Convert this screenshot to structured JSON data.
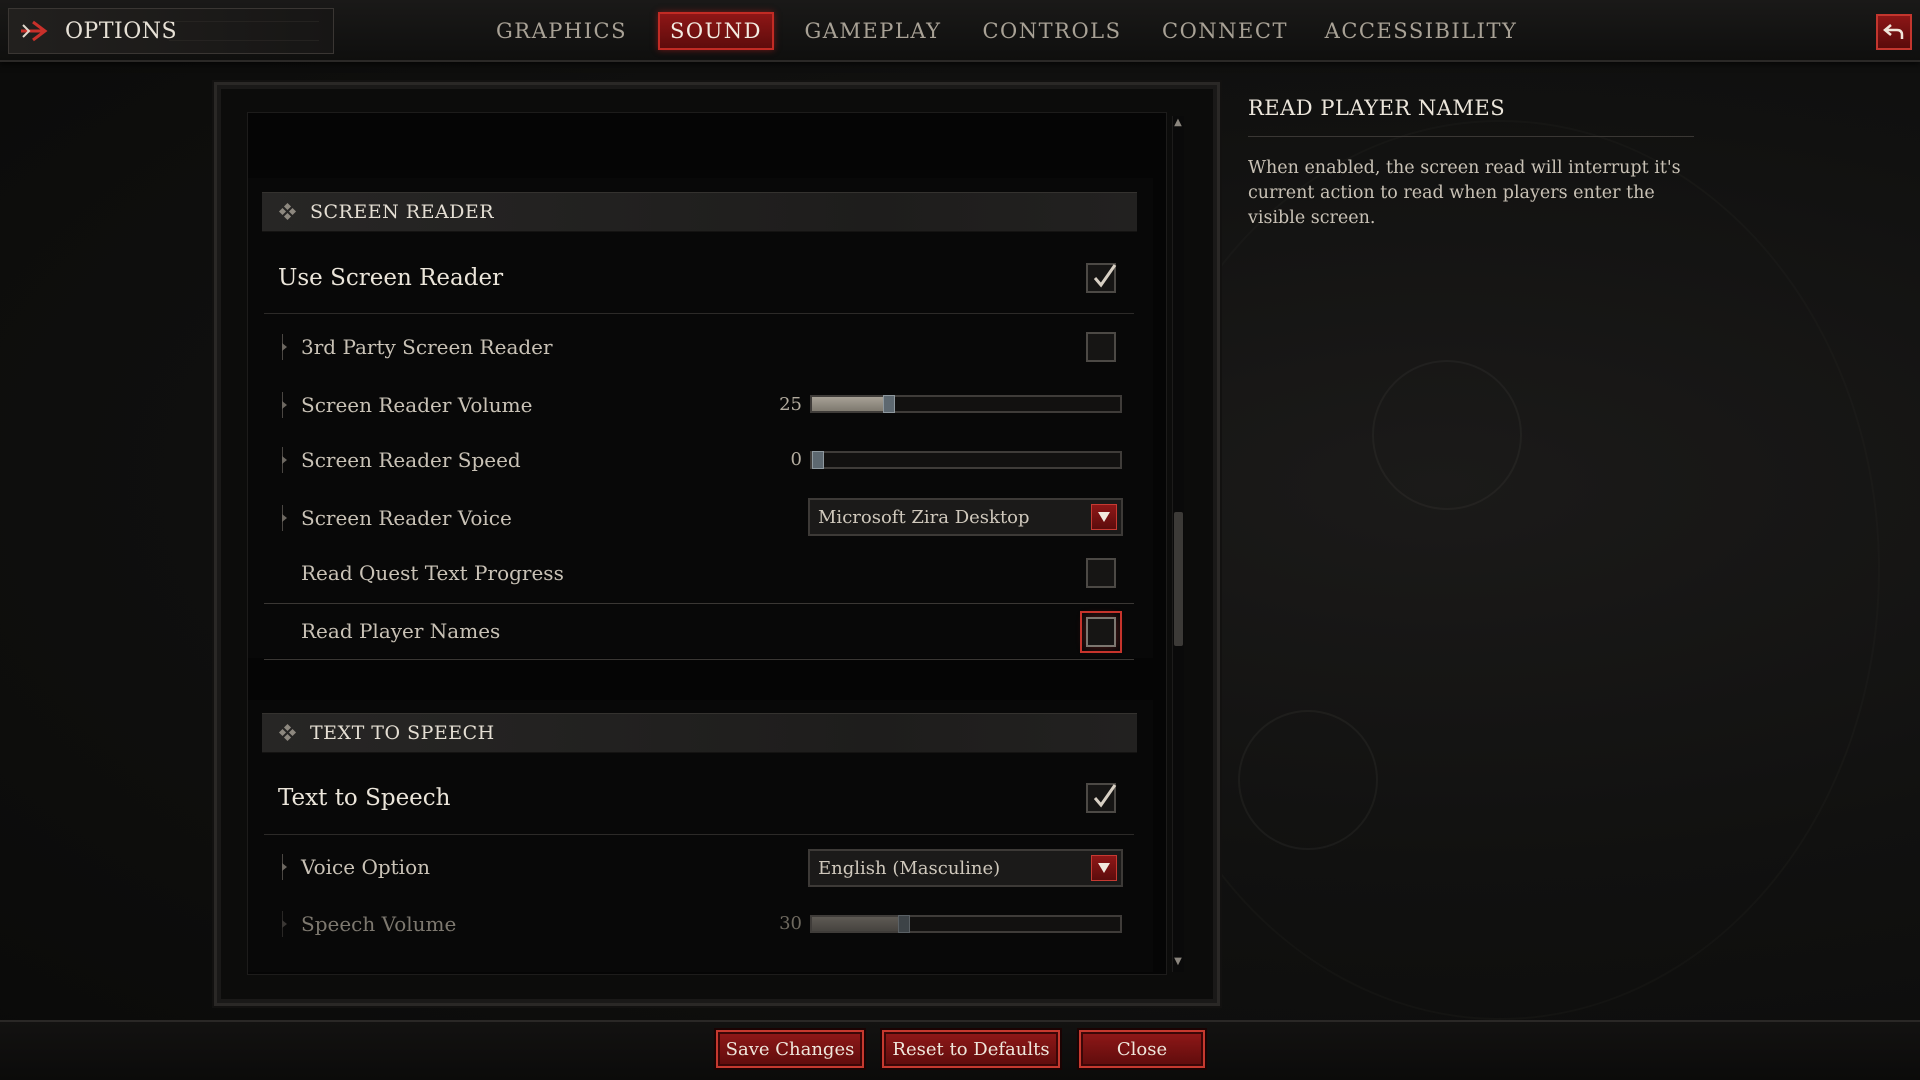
{
  "header": {
    "title": "OPTIONS",
    "tabs": [
      {
        "label": "GRAPHICS",
        "active": false
      },
      {
        "label": "SOUND",
        "active": true
      },
      {
        "label": "GAMEPLAY",
        "active": false
      },
      {
        "label": "CONTROLS",
        "active": false
      },
      {
        "label": "CONNECT",
        "active": false
      },
      {
        "label": "ACCESSIBILITY",
        "active": false
      }
    ],
    "back_icon": "return-arrow-icon"
  },
  "screen_reader": {
    "section_title": "SCREEN READER",
    "use_screen_reader": {
      "label": "Use Screen Reader",
      "checked": true
    },
    "third_party": {
      "label": "3rd Party Screen Reader",
      "checked": false
    },
    "volume": {
      "label": "Screen Reader Volume",
      "value": 25
    },
    "speed": {
      "label": "Screen Reader Speed",
      "value": 0
    },
    "voice": {
      "label": "Screen Reader Voice",
      "selected": "Microsoft Zira Desktop"
    },
    "quest_progress": {
      "label": "Read Quest Text Progress",
      "checked": false
    },
    "player_names": {
      "label": "Read Player Names",
      "checked": false,
      "focused": true
    }
  },
  "text_to_speech": {
    "section_title": "TEXT TO SPEECH",
    "enabled": {
      "label": "Text to Speech",
      "checked": true
    },
    "voice_option": {
      "label": "Voice Option",
      "selected": "English (Masculine)"
    },
    "speech_volume": {
      "label": "Speech Volume",
      "value": 30
    }
  },
  "detail": {
    "title": "READ PLAYER NAMES",
    "description": "When enabled, the screen read will interrupt it's current action to read when players enter the visible screen."
  },
  "footer": {
    "save": "Save Changes",
    "reset": "Reset to Defaults",
    "close": "Close"
  },
  "colors": {
    "accent_red": "#c6392f",
    "button_fill": "#7a1212",
    "text": "#cfc8bc"
  }
}
